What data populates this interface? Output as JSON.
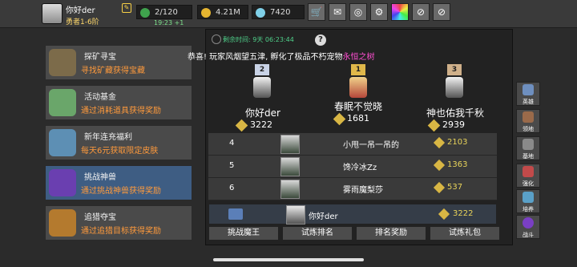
{
  "player": {
    "name": "你好der",
    "rank": "勇者1-6阶"
  },
  "resources": {
    "stamina": "2/120",
    "gold": "4.21M",
    "gems": "7420",
    "timer": "19:23 +1"
  },
  "toolbar_icons": [
    "shop-cart-icon",
    "mail-icon",
    "gamepad-icon",
    "gear-icon",
    "color-wheel-icon",
    "disabled-icon",
    "disabled-icon"
  ],
  "menu": [
    {
      "title": "探矿寻宝",
      "sub": "寻找矿藏获得宝藏",
      "color": "#7c6b4a"
    },
    {
      "title": "活动基金",
      "sub": "通过消耗道具获得奖励",
      "color": "#6aa66a"
    },
    {
      "title": "新年连充福利",
      "sub": "每天6元获取限定皮肤",
      "color": "#5d8fb4"
    },
    {
      "title": "挑战神兽",
      "sub": "通过挑战神兽获得奖励",
      "color": "#6a3fb0"
    },
    {
      "title": "追猎夺宝",
      "sub": "通过追猎目标获得奖励",
      "color": "#b47a2e"
    }
  ],
  "panel": {
    "countdown": "剩余时间: 9天 06:23:44",
    "announce_prefix": "恭喜! 玩家风烟望五津, 孵化了极品不朽宠物",
    "announce_highlight": "永恒之树",
    "top3": [
      {
        "medal": "2",
        "name": "你好der",
        "score": "3222"
      },
      {
        "medal": "1",
        "name": "春眠不觉晓",
        "score": "1681"
      },
      {
        "medal": "3",
        "name": "神也佑我千秋",
        "score": "2939"
      }
    ],
    "rows": [
      {
        "rank": "4",
        "name": "小甩一吊一吊的",
        "score": "2103"
      },
      {
        "rank": "5",
        "name": "馋冷冰Zz",
        "score": "1363"
      },
      {
        "rank": "6",
        "name": "雾雨魔梨莎",
        "score": "537"
      }
    ],
    "me": {
      "name": "你好der",
      "score": "3222"
    },
    "tabs": [
      "挑战魔王",
      "试炼排名",
      "排名奖励",
      "试炼礼包"
    ]
  },
  "side": [
    "英雄",
    "领地",
    "基地",
    "强化",
    "培养",
    "战斗"
  ]
}
